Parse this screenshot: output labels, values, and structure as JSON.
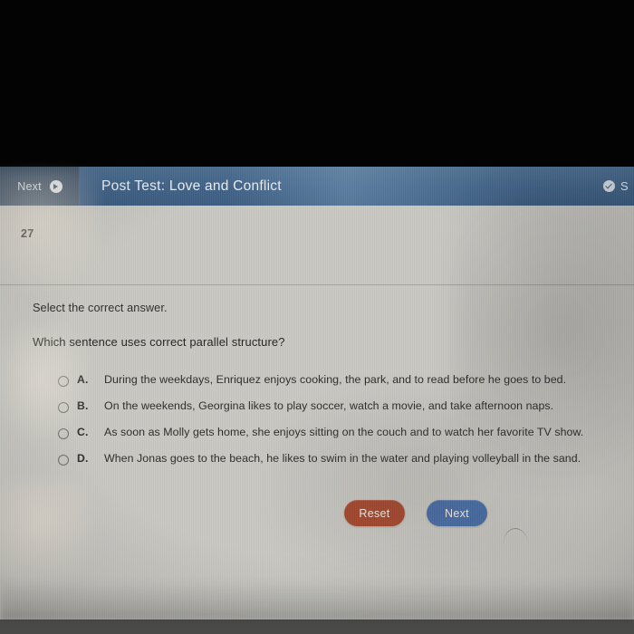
{
  "header": {
    "nav_button_label": "Next",
    "nav_button_icon": "circle-arrow-right-icon",
    "title": "Post Test: Love and Conflict",
    "right_icon": "check-circle-icon",
    "right_label_clipped": "S"
  },
  "question": {
    "number": "27",
    "instruction": "Select the correct answer.",
    "prompt": "Which sentence uses correct parallel structure?",
    "options": [
      {
        "letter": "A.",
        "text": "During the weekdays, Enriquez enjoys cooking, the park, and to read before he goes to bed.",
        "selected": false
      },
      {
        "letter": "B.",
        "text": "On the weekends, Georgina likes to play soccer, watch a movie, and take afternoon naps.",
        "selected": false
      },
      {
        "letter": "C.",
        "text": "As soon as Molly gets home, she enjoys sitting on the couch and to watch her favorite TV show.",
        "selected": false
      },
      {
        "letter": "D.",
        "text": "When Jonas goes to the beach, he likes to swim in the water and playing volleyball in the sand.",
        "selected": false
      }
    ]
  },
  "actions": {
    "reset_label": "Reset",
    "next_label": "Next"
  },
  "colors": {
    "header_blue": "#3f6289",
    "nav_segment": "#44576c",
    "reset_button": "#a8462a",
    "next_button": "#456ca6",
    "page_background": "#c9c8c2",
    "bezel_black": "#030303"
  }
}
